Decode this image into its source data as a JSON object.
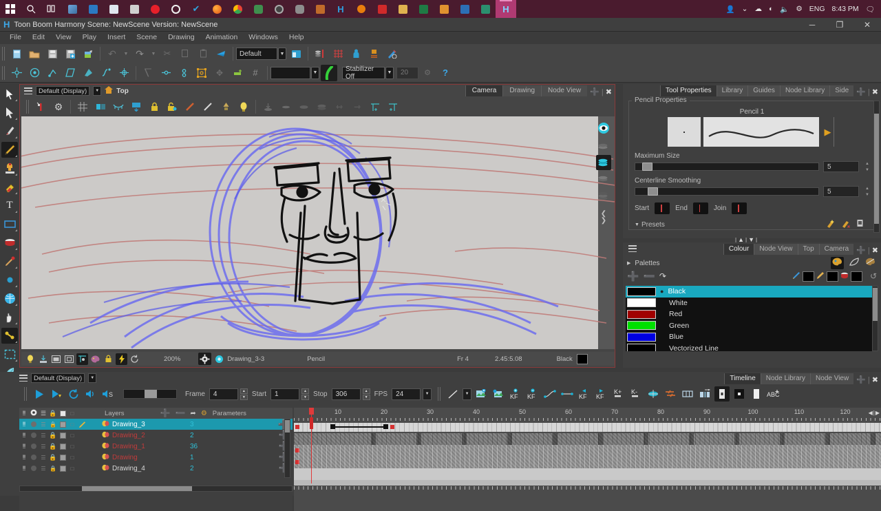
{
  "taskbar": {
    "icons": [
      "start-icon",
      "search-icon",
      "task-view-icon",
      "photos-icon",
      "mail-icon",
      "store-icon",
      "calculator-icon",
      "opera-icon",
      "wps-icon",
      "todo-icon",
      "firefox-icon",
      "chrome-icon",
      "money-icon",
      "settings-icon",
      "gimp-icon",
      "krita-icon",
      "harmony-icon-1",
      "blender-icon",
      "pdf-icon",
      "folder-icon",
      "sheets-icon",
      "player-icon",
      "app-blue-icon",
      "terminal-icon",
      "harmony-icon-2"
    ],
    "tray": {
      "people_icon": "people-icon",
      "chevron": "chevron-up-icon",
      "onedrive_icon": "onedrive-icon",
      "wifi_icon": "wifi-icon",
      "volume_icon": "volume-icon",
      "network_icon": "network-icon",
      "language": "ENG",
      "time": "8:43 PM",
      "notification_icon": "notification-icon"
    }
  },
  "titlebar": {
    "logo": "H",
    "title": "Toon Boom Harmony Scene: NewScene Version: NewScene",
    "minimize": "─",
    "maximize": "❐",
    "close": "✕"
  },
  "menubar": {
    "items": [
      "File",
      "Edit",
      "View",
      "Play",
      "Insert",
      "Scene",
      "Drawing",
      "Animation",
      "Windows",
      "Help"
    ]
  },
  "toolbar_main": {
    "row1_icons": [
      "new-scene-icon",
      "open-scene-icon",
      "save-icon",
      "save-all-icon",
      "export-icon",
      "undo-icon",
      "undo-dropdown-icon",
      "redo-icon",
      "redo-dropdown-icon",
      "cut-icon",
      "copy-icon",
      "paste-icon",
      "paste-special-icon"
    ],
    "workspace_value": "Default",
    "row1_after": [
      "workspace-manager-icon",
      "onion-skin-icon",
      "grid-icon",
      "add-character-icon",
      "add-prop-icon",
      "pencil-check-icon"
    ],
    "row2_icons": [
      "transform-icon",
      "animate-icon",
      "ik-icon",
      "deform-icon",
      "morph-icon",
      "spline-offset-icon",
      "center-pivot-icon",
      "reposition-icon",
      "pivot-icon",
      "pivot-offset-icon",
      "select-frame-icon",
      "snap-icon",
      "contour-snap-icon",
      "grid-snap-icon"
    ],
    "colour_swatch": "",
    "brush_preview_icon": "brush-stroke-icon",
    "stabilizer_label": "Stabilizer Off",
    "stabilizer_value": "20",
    "help_icon": "help-icon"
  },
  "tools_sidebar": {
    "items": [
      {
        "name": "transform-tool",
        "icon": "arrow-cursor-icon",
        "selected": false
      },
      {
        "name": "select-tool",
        "icon": "solid-arrow-icon",
        "selected": false
      },
      {
        "name": "brush-tool",
        "icon": "brush-icon",
        "selected": false
      },
      {
        "name": "pencil-tool",
        "icon": "pencil-icon",
        "selected": true
      },
      {
        "name": "stamp-tool",
        "icon": "stamp-icon",
        "selected": false
      },
      {
        "name": "eraser-tool",
        "icon": "eraser-icon",
        "selected": false
      },
      {
        "name": "text-tool",
        "icon": "text-t-icon",
        "selected": false
      },
      {
        "name": "rectangle-tool",
        "icon": "rectangle-icon",
        "selected": false
      },
      {
        "name": "paint-tool",
        "icon": "paint-bucket-icon",
        "selected": false
      },
      {
        "name": "dropper-tool",
        "icon": "eyedropper-icon",
        "selected": false
      },
      {
        "name": "perspective-tool",
        "icon": "small-node-icon",
        "selected": false
      },
      {
        "name": "deform-tool",
        "icon": "blue-sphere-icon",
        "selected": false
      },
      {
        "name": "hand-tool",
        "icon": "hand-icon",
        "selected": false
      },
      {
        "name": "rigging-tool",
        "icon": "bone-rig-icon",
        "selected": true
      },
      {
        "name": "cutter-tool",
        "icon": "marquee-select-icon",
        "selected": false
      },
      {
        "name": "feather-tool",
        "icon": "feather-icon",
        "selected": false
      },
      {
        "name": "ink-pot-tool",
        "icon": "ink-pot-icon",
        "selected": false
      }
    ]
  },
  "camera_view": {
    "tabs": [
      {
        "label": "Camera",
        "selected": true
      },
      {
        "label": "Drawing",
        "selected": false
      },
      {
        "label": "Node View",
        "selected": false
      }
    ],
    "add_icon": "add-view-icon",
    "close_icon": "close-view-icon",
    "menu_icon": "view-menu-icon",
    "display_value": "Default (Display)",
    "top_label": "Top",
    "toolbar_icons": [
      "add-keyframe-icon",
      "settings-gear-icon",
      "grid-toggle-icon",
      "onion-skin-icon",
      "light-table-icon",
      "import-icon",
      "lock-icon",
      "unlock-icon",
      "red-line-icon",
      "white-line-icon",
      "matte-icon",
      "bulb-icon",
      "stack-bottom-icon",
      "stack-thin-icon",
      "stack-mid-icon",
      "stack-top-icon",
      "flip-h-icon",
      "flip-v-icon",
      "guide-add-icon",
      "guide-add-2-icon"
    ],
    "right_icons": [
      "eye-visible-icon",
      "layer-below-icon",
      "current-layer-icon",
      "layer-above-icon",
      "layer-top-icon"
    ],
    "sidebar_collapse": "collapse-arrow-icon",
    "status": {
      "icons": [
        "bulb-icon",
        "export-icon",
        "window-icon",
        "frame-icon",
        "grid-ref-icon",
        "palette-icon",
        "lock-icon",
        "flash-icon",
        "refresh-icon"
      ],
      "zoom": "200%",
      "gear_icon": "render-gear-icon",
      "layer_icon": "layer-node-icon",
      "layer_name": "Drawing_3-3",
      "tool_name": "Pencil",
      "frame": "Fr 4",
      "coords": "2.45:5.08",
      "colour_name": "Black",
      "colour_hex": "#000000"
    }
  },
  "tool_properties": {
    "tabs": [
      {
        "label": "Tool Properties",
        "selected": true
      },
      {
        "label": "Library",
        "selected": false
      },
      {
        "label": "Guides",
        "selected": false
      },
      {
        "label": "Node Library",
        "selected": false
      },
      {
        "label": "Side",
        "selected": false
      }
    ],
    "add_icon": "add-view-icon",
    "close_icon": "close-view-icon",
    "group_label": "Pencil Properties",
    "pencil_name": "Pencil 1",
    "preview_arrow_icon": "preview-expand-icon",
    "maximum_size_label": "Maximum Size",
    "maximum_size_value": "5",
    "centerline_label": "Centerline Smoothing",
    "centerline_value": "5",
    "start_label": "Start",
    "end_label": "End",
    "join_label": "Join",
    "presets_label": "Presets",
    "presets_arrow_icon": "triangle-down-icon",
    "footer_icons": [
      "new-preset-icon",
      "delete-preset-icon",
      "preset-options-icon"
    ]
  },
  "colour_panel": {
    "tabs": [
      {
        "label": "Colour",
        "selected": true
      },
      {
        "label": "Node View",
        "selected": false
      },
      {
        "label": "Top",
        "selected": false
      },
      {
        "label": "Camera",
        "selected": false
      }
    ],
    "add_icon": "add-view-icon",
    "close_icon": "close-view-icon",
    "menu_icon": "view-menu-icon",
    "palettes_label": "Palettes",
    "palettes_arrow_icon": "triangle-right-icon",
    "mode_icons": [
      "palette-mode-icon",
      "pencil-mode-icon",
      "texture-mode-icon"
    ],
    "action_icons": [
      "add-colour-icon",
      "remove-colour-icon",
      "clone-colour-icon"
    ],
    "pen_icons": [
      "pen-colour-icon",
      "brush-colour-icon",
      "paint-colour-icon",
      "reset-colour-icon"
    ],
    "swatches": [
      {
        "name": "Black",
        "hex": "#000000",
        "selected": true
      },
      {
        "name": "White",
        "hex": "#ffffff",
        "selected": false
      },
      {
        "name": "Red",
        "hex": "#a00000",
        "selected": false
      },
      {
        "name": "Green",
        "hex": "#00e000",
        "selected": false
      },
      {
        "name": "Blue",
        "hex": "#0000e0",
        "selected": false
      },
      {
        "name": "Vectorized Line",
        "hex": "#000000",
        "selected": false
      }
    ]
  },
  "timeline": {
    "tabs": [
      {
        "label": "Timeline",
        "selected": true
      },
      {
        "label": "Node Library",
        "selected": false
      },
      {
        "label": "Node View",
        "selected": false
      }
    ],
    "add_icon": "add-view-icon",
    "close_icon": "close-view-icon",
    "transport_icons": [
      "play-icon",
      "play-selection-icon",
      "loop-icon",
      "sound-on-icon",
      "sound-scrub-icon"
    ],
    "frame_label": "Frame",
    "frame_value": "4",
    "start_label": "Start",
    "start_value": "1",
    "stop_label": "Stop",
    "stop_value": "306",
    "fps_label": "FPS",
    "fps_value": "24",
    "right_icons": [
      "interpolation-icon",
      "interpolation-dropdown-icon",
      "add-drawing-icon",
      "duplicate-drawing-icon",
      "add-kf-icon",
      "remove-kf-icon",
      "ease-icon",
      "constant-icon",
      "kf-prev-icon",
      "kf-next-icon",
      "k-plus-icon",
      "k-minus-icon",
      "onion-icon",
      "flip-icon",
      "thumb-icon",
      "panel-icon",
      "center-icon",
      "dot-icon",
      "white-square-icon",
      "abc-icon"
    ],
    "layers_header": {
      "label": "Layers",
      "params_label": "Parameters",
      "add_icon": "add-layer-icon",
      "remove_icon": "remove-layer-icon",
      "link-icon": "link-layer-icon",
      "group_icon": "group-layer-icon"
    },
    "layers": [
      {
        "name": "Drawing_3",
        "param": "3",
        "selected": true,
        "locked": false,
        "red": false,
        "pencil": true
      },
      {
        "name": "Drawing_2",
        "param": "2",
        "selected": false,
        "locked": true,
        "red": true,
        "pencil": false
      },
      {
        "name": "Drawing_1",
        "param": "36",
        "selected": false,
        "locked": true,
        "red": true,
        "pencil": false
      },
      {
        "name": "Drawing",
        "param": "1",
        "selected": false,
        "locked": true,
        "red": true,
        "pencil": false
      },
      {
        "name": "Drawing_4",
        "param": "2",
        "selected": false,
        "locked": false,
        "red": false,
        "pencil": false
      }
    ],
    "ruler_ticks": [
      "10",
      "20",
      "30",
      "40",
      "50",
      "60",
      "70",
      "80",
      "90",
      "100",
      "110",
      "120"
    ],
    "playhead_frame": 4,
    "zoom_fit_icon": "fit-timeline-icon"
  },
  "colors": {
    "accent": "#19a8bf",
    "window_bg": "#3b3b3b",
    "panel_bg": "#3f3f3f",
    "toolbar_bg": "#454545",
    "canvas_bg": "#575757",
    "taskbar_bg": "#4a1b2e",
    "border_red": "#8b3a3a"
  }
}
